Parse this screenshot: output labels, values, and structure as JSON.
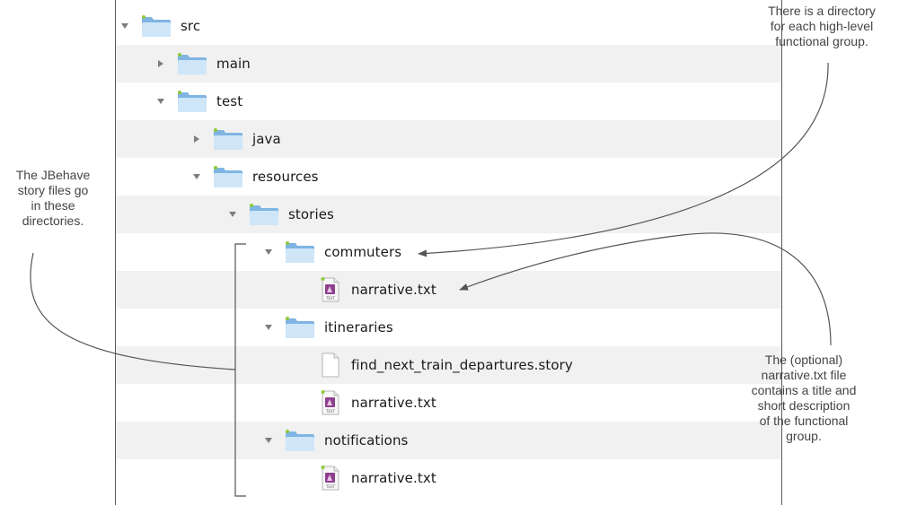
{
  "tree": {
    "rows": [
      {
        "label": "src",
        "kind": "folder",
        "expanded": true
      },
      {
        "label": "main",
        "kind": "folder",
        "expanded": false
      },
      {
        "label": "test",
        "kind": "folder",
        "expanded": true
      },
      {
        "label": "java",
        "kind": "folder",
        "expanded": false
      },
      {
        "label": "resources",
        "kind": "folder",
        "expanded": true
      },
      {
        "label": "stories",
        "kind": "folder",
        "expanded": true
      },
      {
        "label": "commuters",
        "kind": "folder",
        "expanded": true
      },
      {
        "label": "narrative.txt",
        "kind": "text-file"
      },
      {
        "label": "itineraries",
        "kind": "folder",
        "expanded": true
      },
      {
        "label": "find_next_train_departures.story",
        "kind": "story-file"
      },
      {
        "label": "narrative.txt",
        "kind": "text-file"
      },
      {
        "label": "notifications",
        "kind": "folder",
        "expanded": true
      },
      {
        "label": "narrative.txt",
        "kind": "text-file"
      }
    ]
  },
  "annotations": {
    "story_dirs": [
      "The JBehave",
      "story files go",
      "in these",
      "directories."
    ],
    "functional_group": [
      "There is a directory",
      "for each high-level",
      "functional group."
    ],
    "narrative": [
      "The (optional)",
      "narrative.txt file",
      "contains a title and",
      "short description",
      "of the functional",
      "group."
    ]
  },
  "icons": {
    "folder": "folder-icon",
    "text_file": "text-file-icon",
    "story_file": "document-icon",
    "expanded": "triangle-down-icon",
    "collapsed": "triangle-right-icon"
  },
  "colors": {
    "folder_light": "#cfe6f8",
    "folder_dark": "#7fb5e3",
    "zebra": "#f1f1f1",
    "text_file_accent": "#8e3f8c",
    "callout_line": "#555555"
  }
}
